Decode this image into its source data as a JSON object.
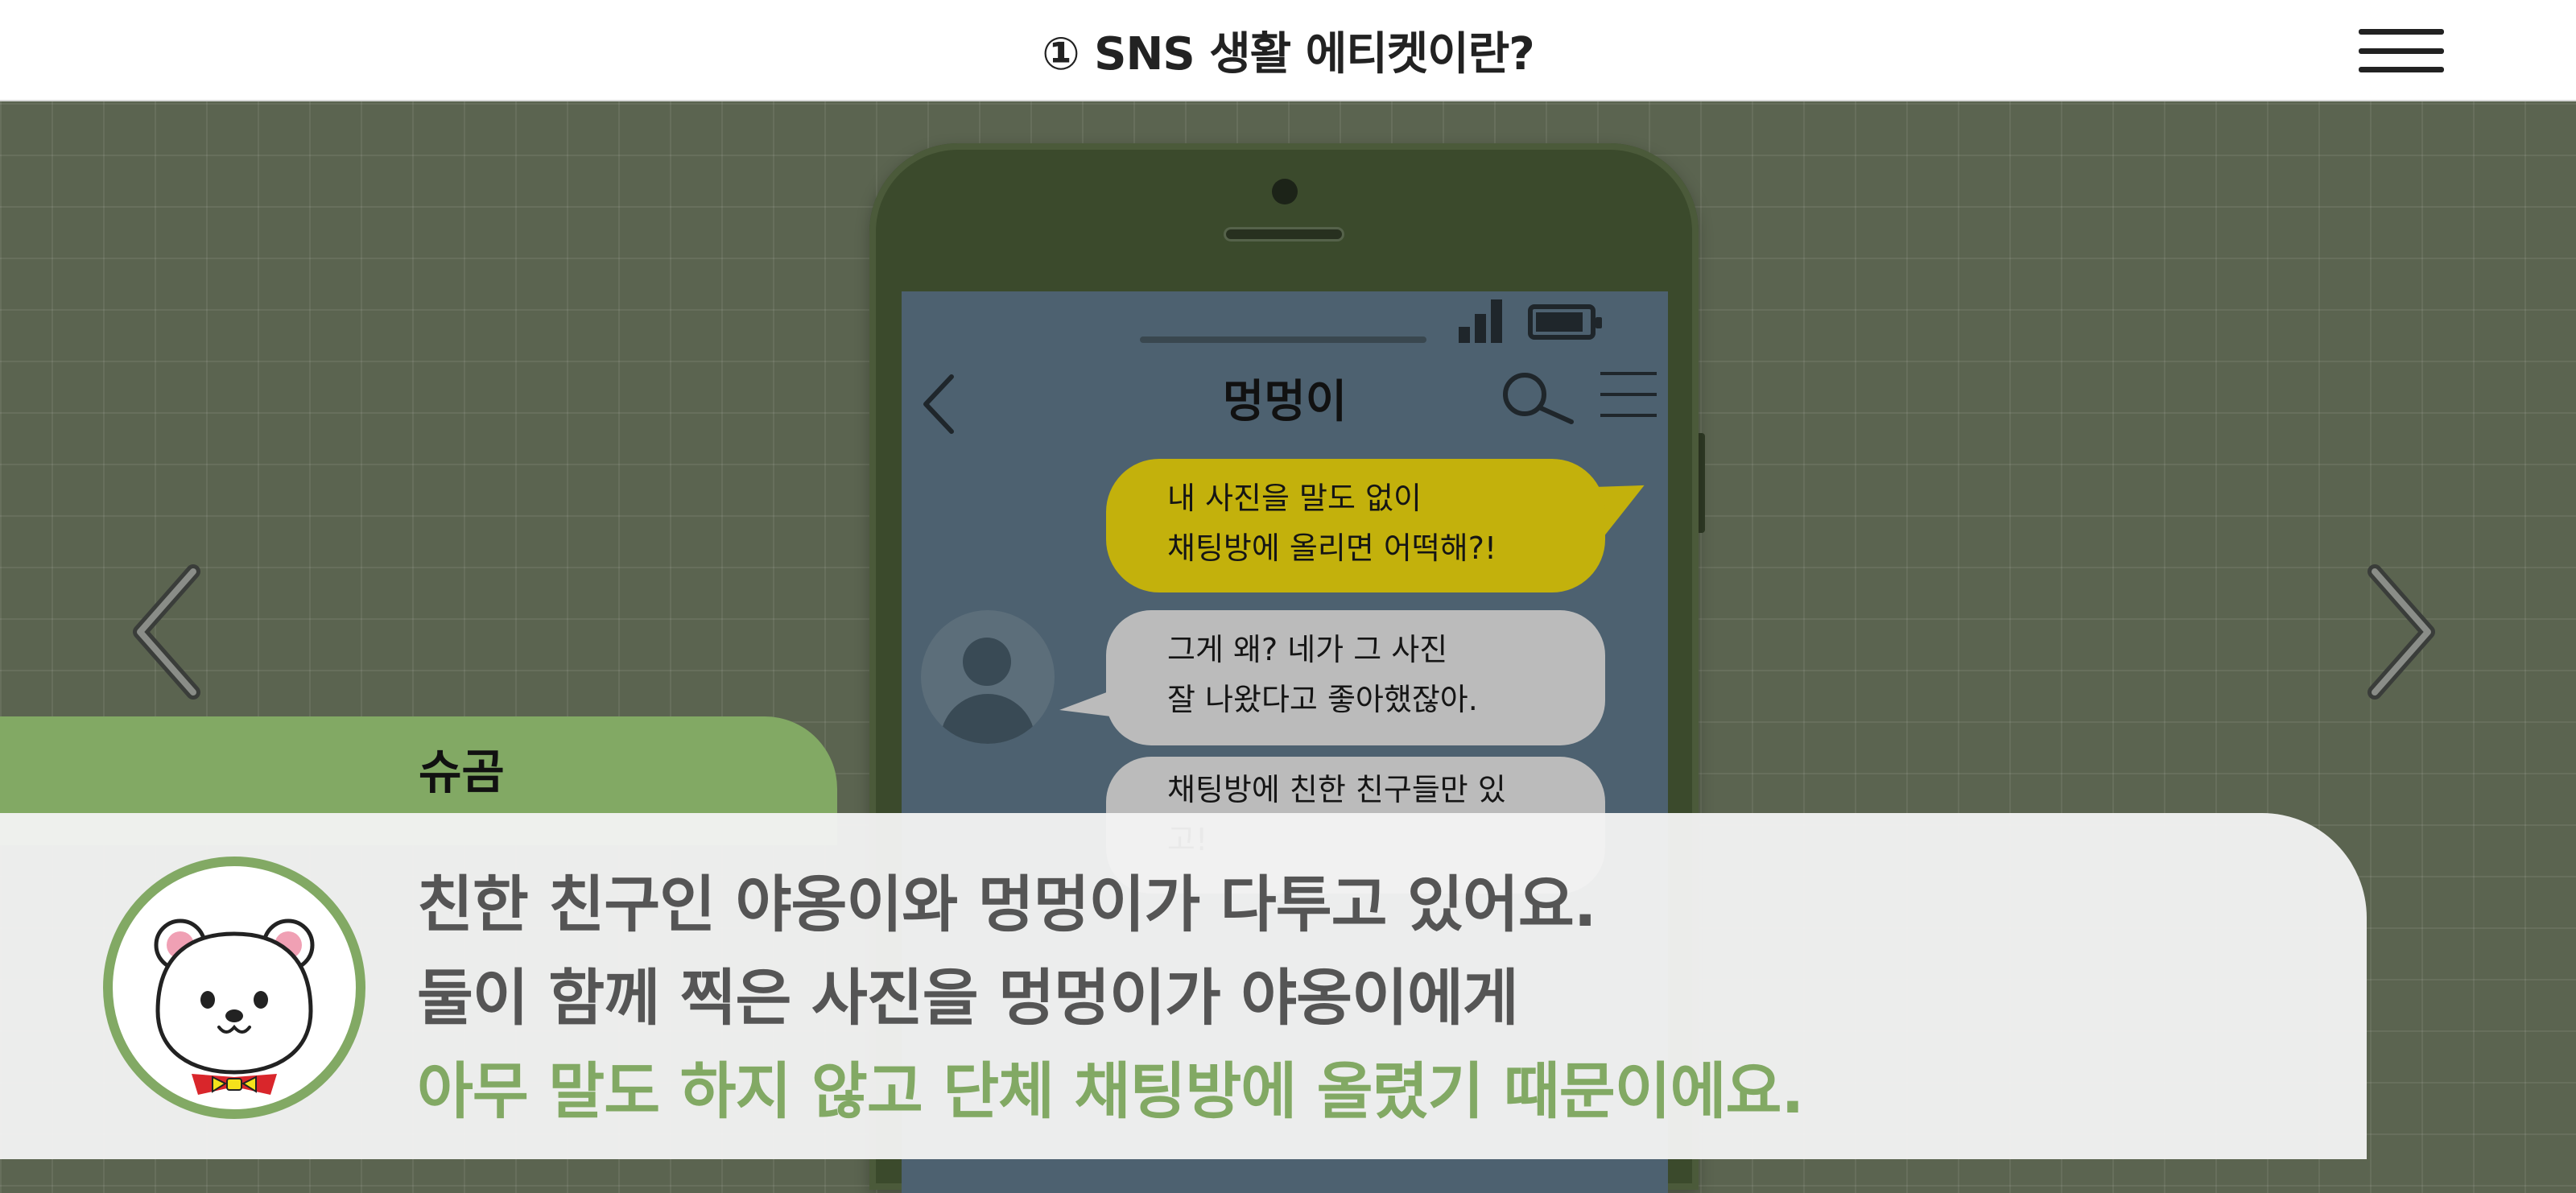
{
  "header": {
    "title": "① SNS 생활 에티켓이란?"
  },
  "chat": {
    "title": "멍멍이",
    "messages": [
      {
        "text": "내 사진을 말도 없이\n채팅방에 올리면 어떡해?!"
      },
      {
        "text": "그게 왜? 네가 그 사진\n잘 나왔다고 좋아했잖아."
      },
      {
        "text": "채팅방에 친한 친구들만 있고!"
      }
    ]
  },
  "dialog": {
    "speaker": "슈곰",
    "lines": [
      "친한 친구인 야옹이와 멍멍이가 다투고 있어요.",
      "둘이 함께 찍은 사진을 멍멍이가 야옹이에게",
      "아무 말도 하지 않고 단체 채팅방에 올렸기 때문이에요."
    ]
  },
  "colors": {
    "background": "#5b6450",
    "accent_green": "#82a964",
    "bubble_yellow": "#c3b10c",
    "bubble_gray": "#bbbbbb",
    "phone_body": "#3b4a2c"
  },
  "icons": {
    "menu": "hamburger-icon",
    "prev": "chevron-left-icon",
    "next": "chevron-right-icon",
    "search": "search-icon",
    "character": "polar-bear-icon"
  }
}
